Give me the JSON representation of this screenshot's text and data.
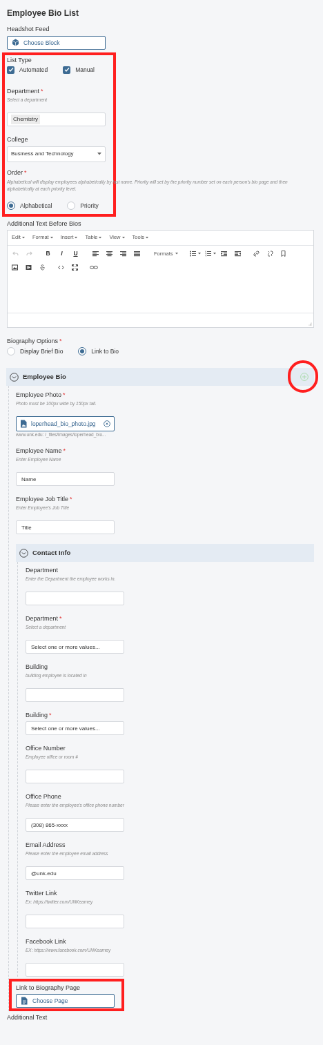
{
  "title": "Employee Bio List",
  "headshot_feed": {
    "label": "Headshot Feed",
    "button": "Choose Block"
  },
  "settings_group": {
    "highlighted": true,
    "list_type": {
      "label": "List Type",
      "options": [
        {
          "label": "Automated",
          "checked": true
        },
        {
          "label": "Manual",
          "checked": true
        }
      ]
    },
    "department": {
      "label": "Department",
      "required": "*",
      "hint": "Select a department",
      "tags": [
        "Chemistry"
      ]
    },
    "college": {
      "label": "College",
      "value": "Business and Technology"
    },
    "order": {
      "label": "Order",
      "required": "*",
      "hint": "Alphabetical will display employees alphabetically by last name. Priority will set by the priority number set on each person's bio page and then alphabetically at each priority level.",
      "options": [
        {
          "label": "Alphabetical",
          "selected": true
        },
        {
          "label": "Priority",
          "selected": false
        }
      ]
    }
  },
  "additional_text_before": {
    "label": "Additional Text Before Bios",
    "menus": [
      "Edit",
      "Format",
      "Insert",
      "Table",
      "View",
      "Tools"
    ],
    "text_buttons": [
      "B",
      "I",
      "U"
    ],
    "formats": "Formats",
    "undo_redo_disabled": true
  },
  "biography_options": {
    "label": "Biography Options",
    "required": "*",
    "options": [
      {
        "label": "Display Brief Bio",
        "selected": false
      },
      {
        "label": "Link to Bio",
        "selected": true
      }
    ]
  },
  "employee_bio": {
    "title": "Employee Bio",
    "expanded": true,
    "add_highlighted": true,
    "fields": [
      {
        "kind": "file",
        "label": "Employee Photo",
        "required": "*",
        "hint": "Photo must be 100px wide by 150px tall.",
        "value": "loperhead_bio_photo.jpg",
        "path": "www.unk.edu: /_files/images/loperhead_bio..."
      },
      {
        "kind": "text",
        "label": "Employee Name",
        "required": "*",
        "hint": "Enter Employee Name",
        "value": "Name"
      },
      {
        "kind": "text",
        "label": "Employee Job Title",
        "required": "*",
        "hint": "Enter Employee's Job Title",
        "value": "Title"
      }
    ],
    "contact_info": {
      "title": "Contact Info",
      "expanded": true,
      "fields": [
        {
          "kind": "text",
          "label": "Department",
          "hint": "Enter the Department the employee works in."
        },
        {
          "kind": "select",
          "label": "Department",
          "required": "*",
          "hint": "Select a department",
          "placeholder": "Select one or more values..."
        },
        {
          "kind": "text",
          "label": "Building",
          "hint": "building employee is located in"
        },
        {
          "kind": "select",
          "label": "Building",
          "required": "*",
          "placeholder": "Select one or more values..."
        },
        {
          "kind": "text",
          "label": "Office Number",
          "hint": "Employee office or room #"
        },
        {
          "kind": "text",
          "label": "Office Phone",
          "hint": "Please enter the employee's office phone number",
          "value": "(308) 865-xxxx"
        },
        {
          "kind": "text",
          "label": "Email Address",
          "hint": "Please enter the employee email address",
          "value": "@unk.edu"
        },
        {
          "kind": "text",
          "label": "Twitter Link",
          "hint": "Ex: https://twitter.com/UNKearney"
        },
        {
          "kind": "text",
          "label": "Facebook Link",
          "hint": "EX: https://www.facebook.com/UNKearney"
        }
      ]
    },
    "link_to_bio": {
      "label": "Link to Biography Page",
      "button": "Choose Page",
      "highlighted": true
    }
  },
  "additional_text": {
    "label": "Additional Text"
  }
}
